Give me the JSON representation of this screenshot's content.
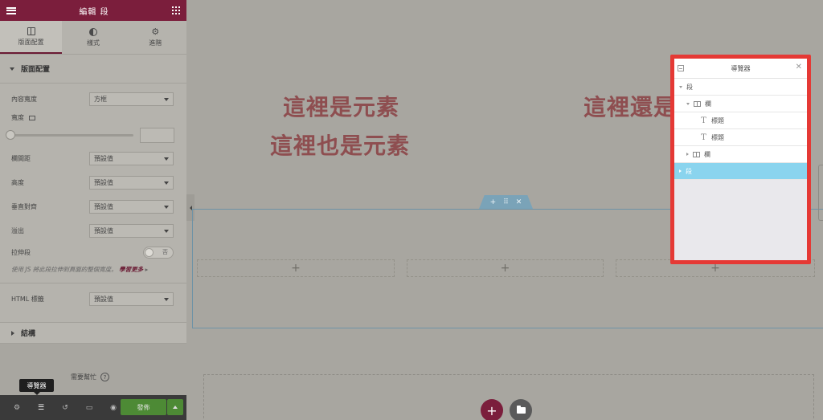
{
  "panel": {
    "title": "編輯 段",
    "tabs": [
      {
        "label": "版面配置"
      },
      {
        "label": "樣式"
      },
      {
        "label": "進階"
      }
    ],
    "section_title": "版面配置",
    "controls": {
      "content_width": {
        "label": "內容寬度",
        "value": "方框"
      },
      "width": {
        "label": "寬度"
      },
      "column_gap": {
        "label": "欄間距",
        "value": "預設值"
      },
      "height": {
        "label": "高度",
        "value": "預設值"
      },
      "vertical_align": {
        "label": "垂直對齊",
        "value": "預設值"
      },
      "overflow": {
        "label": "溢出",
        "value": "預設值"
      },
      "stretch": {
        "label": "拉伸段",
        "toggle_text": "否"
      },
      "hint": "使用 JS 將此段拉伸到頁面的整個寬度。",
      "hint_link": "學習更多",
      "html_tag": {
        "label": "HTML 標籤",
        "value": "預設值"
      }
    },
    "structure_title": "結構",
    "help_text": "需要幫忙",
    "tooltip": "導覽器",
    "publish_label": "發佈"
  },
  "canvas": {
    "heading_1": "這裡是元素",
    "heading_2": "這裡也是元素",
    "heading_3": "這裡還是"
  },
  "navigator": {
    "title": "導覽器",
    "rows": [
      {
        "label": "段"
      },
      {
        "label": "欄"
      },
      {
        "label": "標題"
      },
      {
        "label": "標題"
      },
      {
        "label": "欄"
      },
      {
        "label": "段"
      }
    ]
  },
  "colors": {
    "brand": "#7b1e3c",
    "publish": "#4d8a35",
    "navigator_border": "#e53935",
    "navigator_active": "#8ad4ee",
    "section_outline": "#6e93a6"
  }
}
